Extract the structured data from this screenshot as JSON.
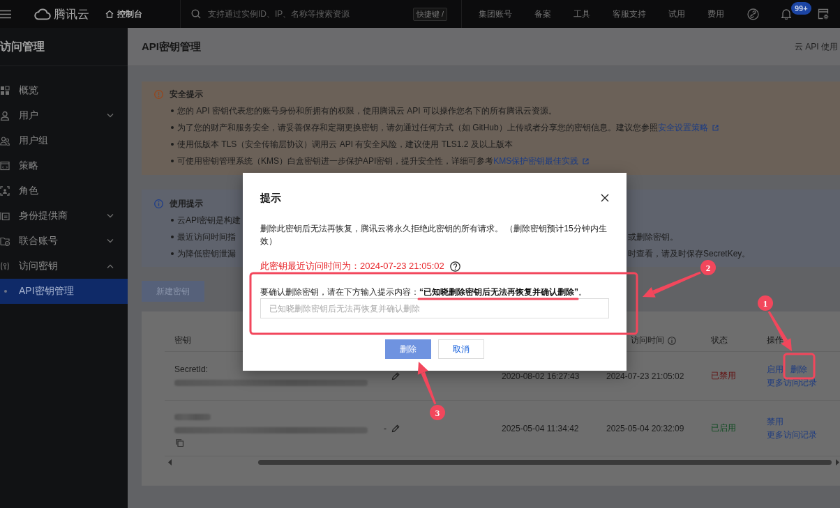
{
  "top_bar": {
    "brand": "腾讯云",
    "console_link": "控制台",
    "search": {
      "placeholder": "支持通过实例ID、IP、名称等搜索资源",
      "shortcut": "快捷键 /"
    },
    "nav_links": [
      "集团账号",
      "备案",
      "工具",
      "客服支持",
      "试用",
      "费用"
    ],
    "notification_badge": "99+"
  },
  "sidebar": {
    "title": "访问管理",
    "items": [
      {
        "label": "概览",
        "kind": "link",
        "selected": false
      },
      {
        "label": "用户",
        "kind": "group",
        "expanded": false,
        "selected": false
      },
      {
        "label": "用户组",
        "kind": "link",
        "selected": false
      },
      {
        "label": "策略",
        "kind": "link",
        "selected": false
      },
      {
        "label": "角色",
        "kind": "link",
        "selected": false
      },
      {
        "label": "身份提供商",
        "kind": "group",
        "expanded": false,
        "selected": false
      },
      {
        "label": "联合账号",
        "kind": "group",
        "expanded": false,
        "selected": false
      },
      {
        "label": "访问密钥",
        "kind": "group",
        "expanded": true,
        "selected": false,
        "children": [
          {
            "label": "API密钥管理",
            "selected": true
          }
        ]
      }
    ]
  },
  "page_header": {
    "title": "API密钥管理",
    "right_link": "云 API 使用"
  },
  "security_tips": {
    "title": "安全提示",
    "items": [
      {
        "text": "您的 API 密钥代表您的账号身份和所拥有的权限，使用腾讯云 API 可以操作您名下的所有腾讯云资源。"
      },
      {
        "text": "为了您的财产和服务安全，请妥善保存和定期更换密钥，请勿通过任何方式（如 GitHub）上传或者分享您的密钥信息。建议您参照",
        "link": "安全设置策略"
      },
      {
        "text": "使用低版本 TLS（安全传输层协议）调用云 API 有安全风险，建议使用 TLS1.2 及以上版本"
      },
      {
        "text": "可使用密钥管理系统（KMS）白盒密钥进一步保护API密钥，提升安全性，详细可参考",
        "link": "KMS保护密钥最佳实践"
      }
    ]
  },
  "usage_tips": {
    "title": "使用提示",
    "items": [
      {
        "start": "云API密钥是构建"
      },
      {
        "start": "最近访问时间指",
        "end": "或删除密钥。"
      },
      {
        "start": "为降低密钥泄漏",
        "end": "时查看，请及时保存SecretKey。"
      }
    ]
  },
  "new_key_button": "新建密钥",
  "key_table": {
    "headers": {
      "secret": "密钥",
      "last_access": "访问时间",
      "status": "状态",
      "actions": "操作"
    },
    "rows": [
      {
        "secret_label": "SecretId:",
        "copyable": false,
        "column_3": "2020-08-02 16:27:43",
        "last_access": "2024-07-23 21:05:02",
        "status": {
          "text": "已禁用",
          "color": "#621010"
        },
        "actions": [
          "启用",
          "删除"
        ],
        "more_link": "更多访问记录"
      },
      {
        "copyable": true,
        "column_2": "-",
        "column_3": "2025-05-04 11:34:42",
        "last_access": "2025-05-04 20:32:09",
        "status": {
          "text": "已启用",
          "color": "#0c4a1f"
        },
        "actions": [
          "禁用"
        ],
        "more_link": "更多访问记录"
      }
    ]
  },
  "dialog": {
    "title": "提示",
    "message": "删除此密钥后无法再恢复，腾讯云将永久拒绝此密钥的所有请求。 （删除密钥预计15分钟内生效）",
    "last_access_notice": "此密钥最近访问时间为：2024-07-23 21:05:02",
    "confirm_prompt": "要确认删除密钥，请在下方输入提示内容：**“已知晓删除密钥后无法再恢复并确认删除”**。",
    "confirm_input": {
      "placeholder": "已知晓删除密钥后无法再恢复并确认删除"
    },
    "buttons": [
      {
        "label": "删除",
        "kind": "primary",
        "disabled": true
      },
      {
        "label": "取消",
        "kind": "secondary",
        "disabled": false
      }
    ]
  },
  "annotations": {
    "steps": [
      "1",
      "2",
      "3"
    ]
  }
}
